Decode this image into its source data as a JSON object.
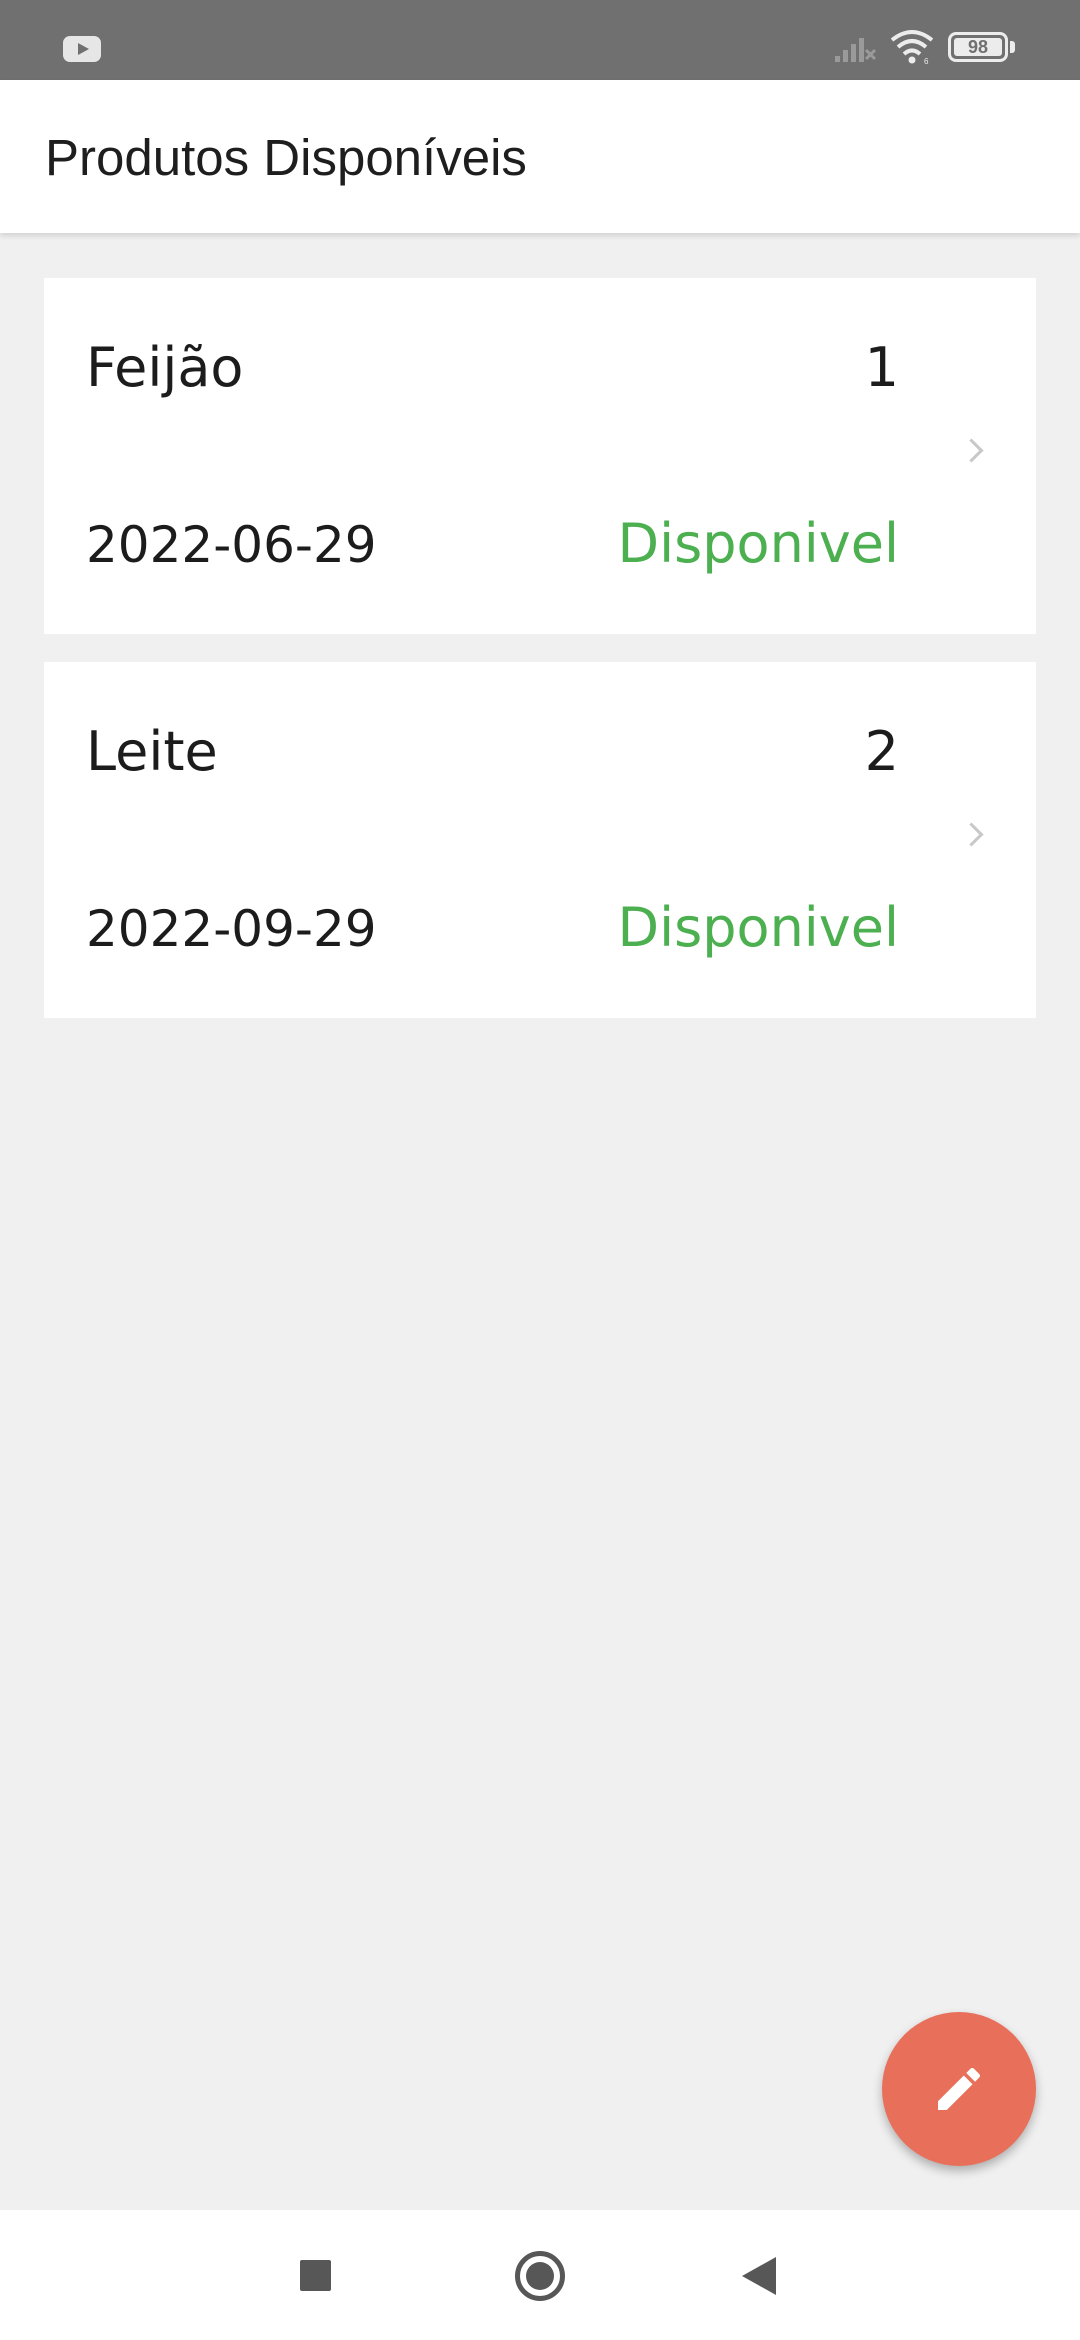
{
  "status_bar": {
    "battery_level": "98",
    "app_notification_icon": "youtube-icon",
    "signal_icon": "signal-no-service-icon",
    "wifi_icon": "wifi-icon"
  },
  "app_bar": {
    "title": "Produtos Disponíveis"
  },
  "products": [
    {
      "name": "Feijão",
      "quantity": "1",
      "date": "2022-06-29",
      "status": "Disponivel"
    },
    {
      "name": "Leite",
      "quantity": "2",
      "date": "2022-09-29",
      "status": "Disponivel"
    }
  ],
  "fab": {
    "icon": "pencil-icon"
  },
  "nav_bar": {
    "recents_icon": "square-icon",
    "home_icon": "circle-icon",
    "back_icon": "triangle-back-icon"
  },
  "colors": {
    "status_bar_bg": "#707070",
    "background": "#f0f0f0",
    "card_bg": "#ffffff",
    "status_available": "#4caf50",
    "fab": "#e8705a",
    "nav_icons": "#575757"
  }
}
